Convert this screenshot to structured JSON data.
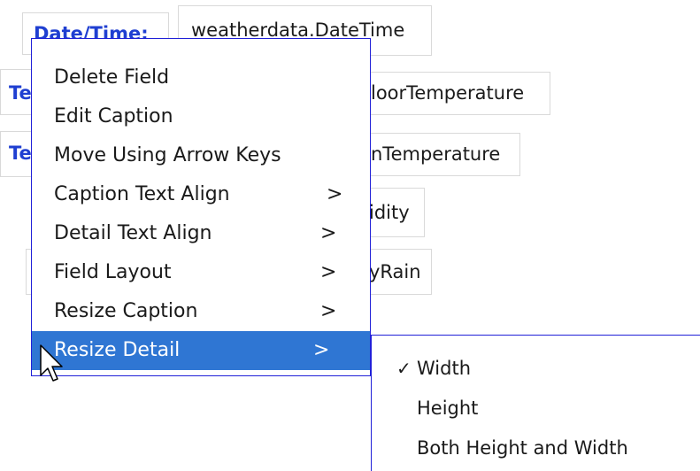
{
  "fields": [
    {
      "caption": "Date/Time:",
      "detail": "weatherdata.DateTime"
    },
    {
      "caption_partial": "Te",
      "detail_partial": "loorTemperature"
    },
    {
      "caption_partial": "Te",
      "detail_partial": "nTemperature"
    },
    {
      "detail_partial": "idity"
    },
    {
      "detail_partial": "yRain"
    }
  ],
  "context_menu": {
    "items": [
      {
        "label": "Delete Field",
        "arrow": ""
      },
      {
        "label": "Edit Caption",
        "arrow": ""
      },
      {
        "label": "Move Using Arrow Keys",
        "arrow": ""
      },
      {
        "label": "Caption Text Align",
        "arrow": ">"
      },
      {
        "label": "Detail Text Align",
        "arrow": ">"
      },
      {
        "label": "Field Layout",
        "arrow": ">"
      },
      {
        "label": "Resize Caption",
        "arrow": ">"
      },
      {
        "label": "Resize Detail",
        "arrow": ">"
      }
    ],
    "highlighted_index": 7,
    "highlight_color": "#2f76d3",
    "border_color": "#2020d8"
  },
  "submenu": {
    "items": [
      {
        "label": "Width",
        "check": "✓"
      },
      {
        "label": "Height",
        "check": ""
      },
      {
        "label": "Both Height and Width",
        "check": ""
      }
    ]
  },
  "colors": {
    "caption_link": "#1f3fd1",
    "field_border": "#d9d9d9"
  }
}
